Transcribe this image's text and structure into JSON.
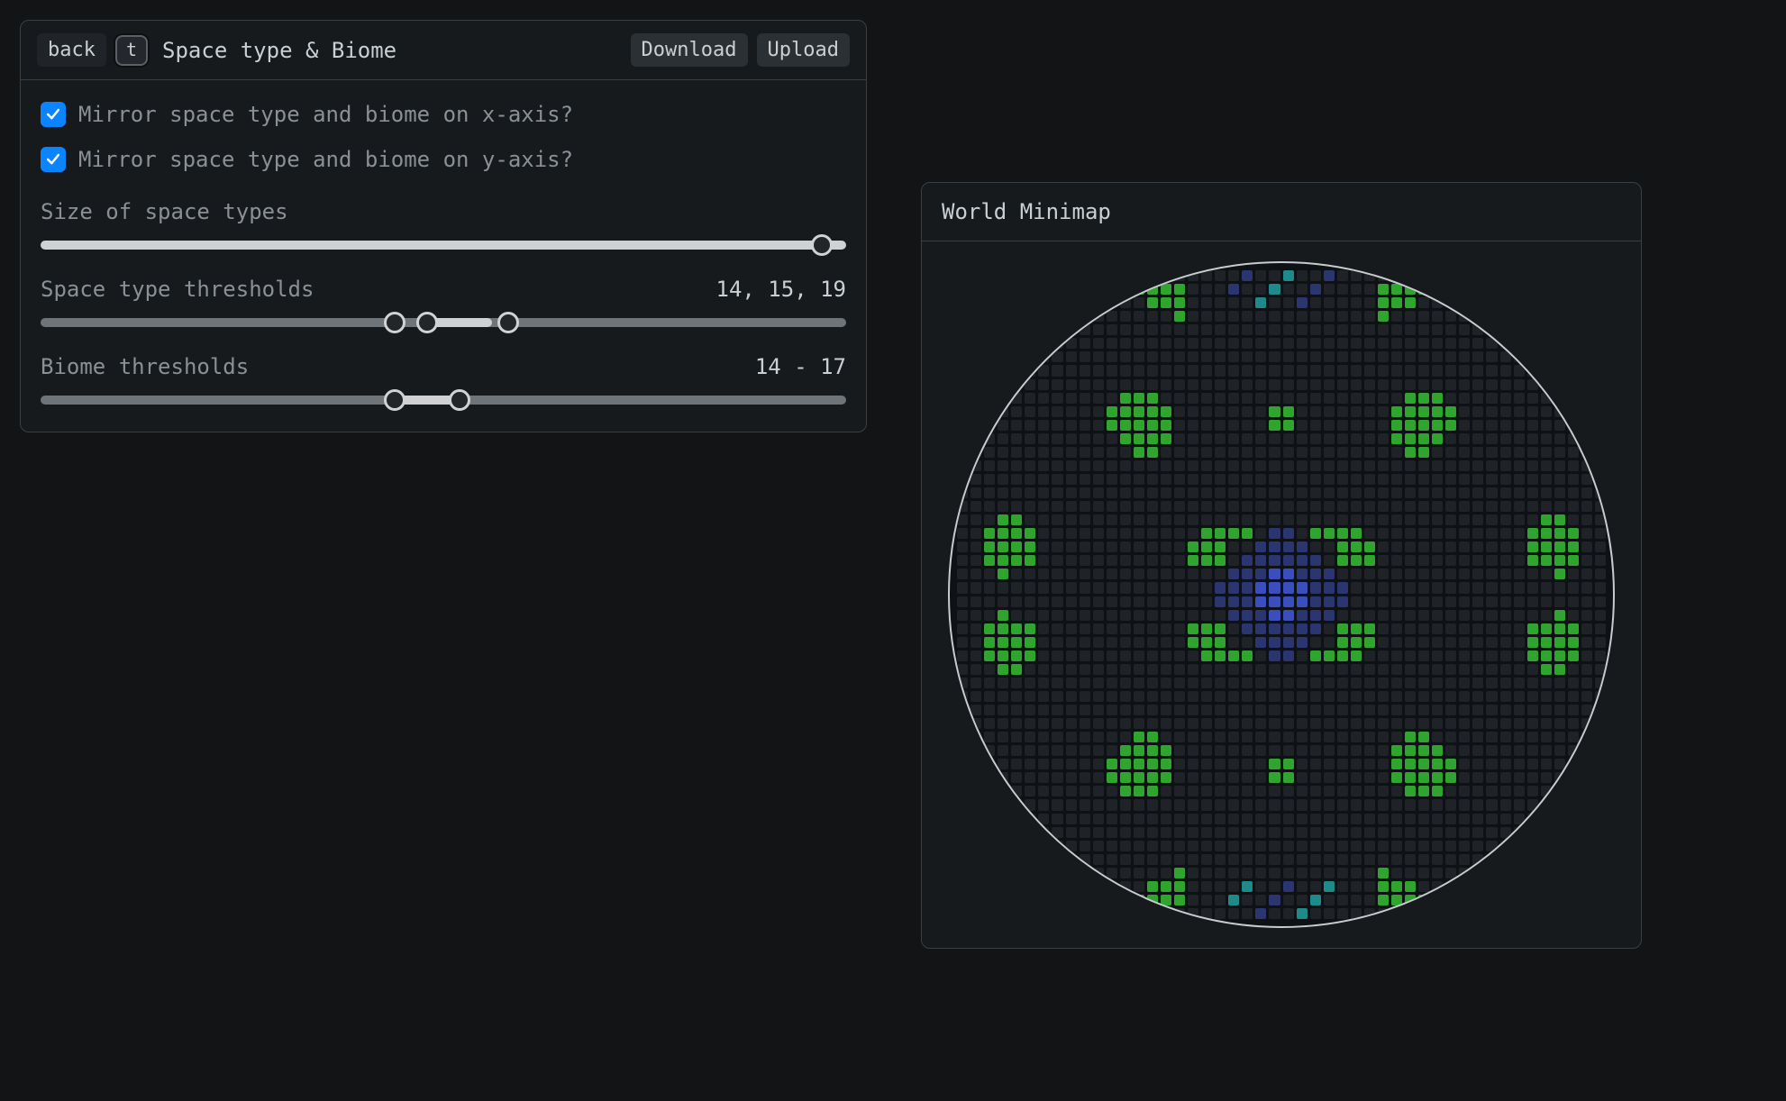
{
  "config_panel": {
    "back_label": "back",
    "shortcut_key": "t",
    "title": "Space type & Biome",
    "download_label": "Download",
    "upload_label": "Upload",
    "mirror_x": {
      "label": "Mirror space type and biome on x-axis?",
      "checked": true
    },
    "mirror_y": {
      "label": "Mirror space type and biome on y-axis?",
      "checked": true
    },
    "size_slider": {
      "label": "Size of space types",
      "value_pct": 97
    },
    "space_thresholds": {
      "label": "Space type thresholds",
      "value_display": "14, 15, 19",
      "thumbs_pct": [
        44,
        48,
        58
      ],
      "light_segment": [
        48,
        56
      ]
    },
    "biome_thresholds": {
      "label": "Biome thresholds",
      "value_display": "14 - 17",
      "thumbs_pct": [
        44,
        52
      ],
      "light_segment": [
        44,
        52
      ]
    }
  },
  "minimap": {
    "title": "World Minimap",
    "grid_size": 48,
    "colors": {
      "empty": "#1f2327",
      "green": "#2fa52f",
      "blue": "#3a4fbd",
      "dark_blue": "#2b3570",
      "teal": "#1e8a8a"
    }
  }
}
